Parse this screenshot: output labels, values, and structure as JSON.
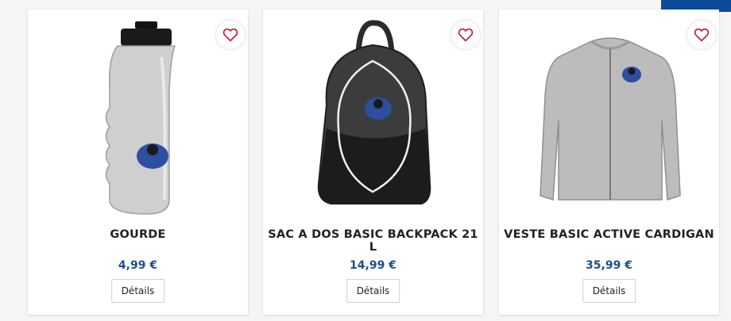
{
  "products": [
    {
      "name": "GOURDE",
      "price": "4,99 €",
      "details_label": "Détails",
      "image_icon": "water-bottle-icon"
    },
    {
      "name": "SAC A DOS BASIC BACKPACK 21 L",
      "price": "14,99 €",
      "details_label": "Détails",
      "image_icon": "backpack-icon"
    },
    {
      "name": "VESTE BASIC ACTIVE CARDIGAN",
      "price": "35,99 €",
      "details_label": "Détails",
      "image_icon": "cardigan-icon"
    }
  ],
  "favorite_icon": "heart-outline-icon",
  "colors": {
    "price": "#1d4f8a",
    "heart": "#c0192f",
    "corner": "#0a4c9a"
  }
}
